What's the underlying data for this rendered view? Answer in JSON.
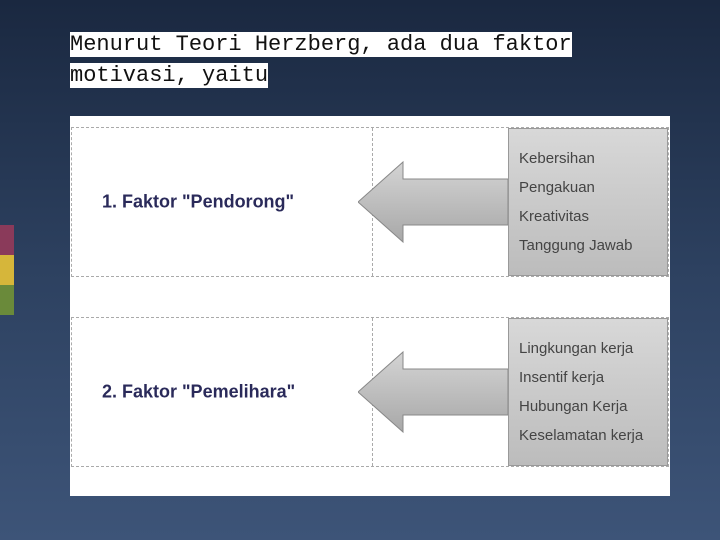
{
  "title": "Menurut Teori Herzberg, ada dua faktor motivasi, yaitu",
  "factors": {
    "f1": {
      "label": "1. Faktor \"Pendorong\"",
      "items": [
        "Kebersihan",
        "Pengakuan",
        "Kreativitas",
        "Tanggung Jawab"
      ]
    },
    "f2": {
      "label": "2. Faktor \"Pemelihara\"",
      "items": [
        "Lingkungan kerja",
        "Insentif kerja",
        "Hubungan Kerja",
        "Keselamatan kerja"
      ]
    }
  }
}
